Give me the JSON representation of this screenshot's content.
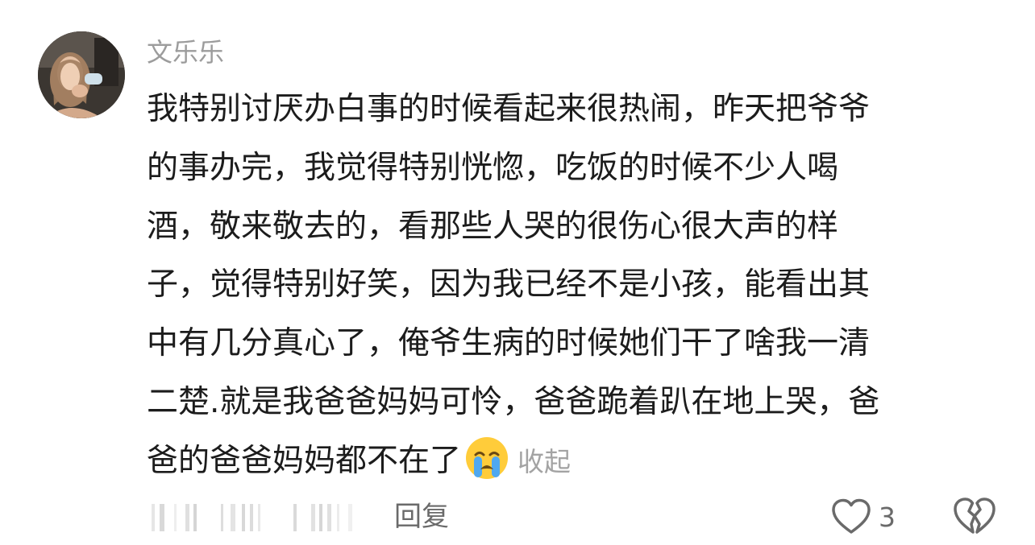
{
  "comment": {
    "username": "文乐乐",
    "lines": [
      "我特别讨厌办白事的时候看起来很热闹，昨天把爷爷",
      "的事办完，我觉得特别恍惚，吃饭的时候不少人喝",
      "酒，敬来敬去的，看那些人哭的很伤心很大声的样",
      "子，觉得特别好笑，因为我已经不是小孩，能看出其",
      "中有几分真心了，俺爷生病的时候她们干了啥我一清",
      "二楚.就是我爸爸妈妈可怜，爸爸跪着趴在地上哭，爸",
      "爸的爸爸妈妈都不在了"
    ],
    "emoji_icon": "loudly-crying-face-emoji",
    "collapse_label": "收起"
  },
  "actions": {
    "reply_label": "回复",
    "like_icon": "heart-outline-icon",
    "like_count": "3",
    "dislike_icon": "broken-heart-outline-icon"
  },
  "colors": {
    "username": "#9c9c9c",
    "body_text": "#1c1c1c",
    "collapse": "#a3a3a3",
    "action_text": "#6a6a6a"
  }
}
